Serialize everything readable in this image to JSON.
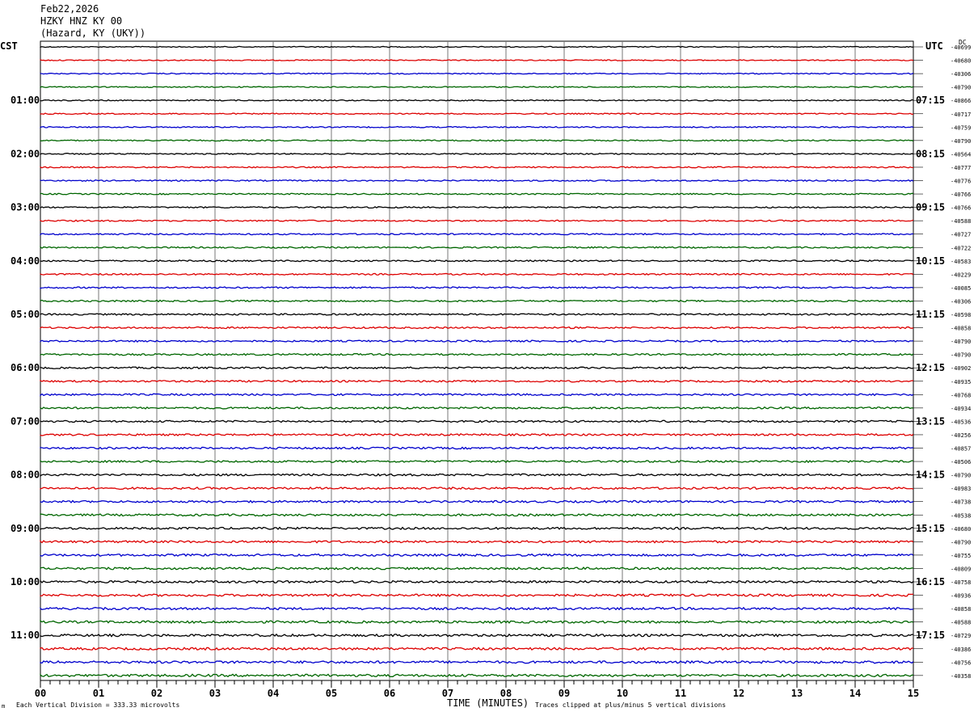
{
  "header": {
    "date": "Feb22,2026",
    "station": "HZKY HNZ KY 00",
    "location": "(Hazard, KY (UKY))"
  },
  "left_timezone": "CST",
  "right_timezone": "UTC",
  "dc_label": "DC",
  "footer": {
    "scale_note": "Each Vertical Division =  333.33 microvolts",
    "xlabel": "TIME (MINUTES)",
    "clip_note": "Traces clipped at plus/minus 5 vertical divisions",
    "corner_mark": "m"
  },
  "chart_data": {
    "type": "line",
    "xlabel": "TIME (MINUTES)",
    "xlim": [
      0,
      15
    ],
    "x_ticks": [
      "00",
      "01",
      "02",
      "03",
      "04",
      "05",
      "06",
      "07",
      "08",
      "09",
      "10",
      "11",
      "12",
      "13",
      "14",
      "15"
    ],
    "left_hour_labels": [
      "01:00",
      "02:00",
      "03:00",
      "04:00",
      "05:00",
      "06:00",
      "07:00",
      "08:00",
      "09:00",
      "10:00",
      "11:00"
    ],
    "right_hour_labels": [
      "07:15",
      "08:15",
      "09:15",
      "10:15",
      "11:15",
      "12:15",
      "13:15",
      "14:15",
      "15:15",
      "16:15",
      "17:15"
    ],
    "trace_colors": [
      "#000000",
      "#dd0000",
      "#0000cc",
      "#006600"
    ],
    "trace_count": 48,
    "dc_offsets": [
      "-40699",
      "-40680",
      "-40306",
      "-40790",
      "-40866",
      "-40717",
      "-40759",
      "-40790",
      "-40564",
      "-40777",
      "-40776",
      "-40766",
      "-40766",
      "-40588",
      "-40727",
      "-40722",
      "-40583",
      "-40229",
      "-40085",
      "-40306",
      "-40598",
      "-40858",
      "-40790",
      "-40790",
      "-40902",
      "-40935",
      "-40768",
      "-40934",
      "-40536",
      "-40256",
      "-40857",
      "-40506",
      "-40790",
      "-40983",
      "-40738",
      "-40538",
      "-40680",
      "-40790",
      "-40755",
      "-40809",
      "-40758",
      "-40936",
      "-40858",
      "-40588",
      "-40729",
      "-40386",
      "-40756",
      "-40358"
    ],
    "grid": true
  }
}
